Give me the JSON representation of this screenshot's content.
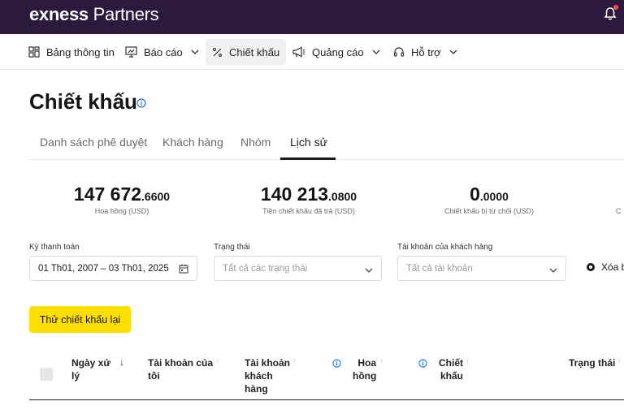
{
  "brand": {
    "name": "exness",
    "product": "Partners"
  },
  "nav": {
    "items": [
      {
        "label": "Bảng thông tin"
      },
      {
        "label": "Báo cáo"
      },
      {
        "label": "Chiết khấu"
      },
      {
        "label": "Quảng cáo"
      },
      {
        "label": "Hỗ trợ"
      }
    ]
  },
  "page": {
    "title": "Chiết khấu"
  },
  "tabs": [
    {
      "label": "Danh sách phê duyệt"
    },
    {
      "label": "Khách hàng"
    },
    {
      "label": "Nhóm"
    },
    {
      "label": "Lịch sử"
    }
  ],
  "stats": [
    {
      "main": "147 672",
      "decimal": ".6600",
      "label": "Hoa hồng (USD)"
    },
    {
      "main": "140 213",
      "decimal": ".0800",
      "label": "Tiền chiết khấu đã trả (USD)"
    },
    {
      "main": "0",
      "decimal": ".0000",
      "label": "Chiết khấu bị từ chối (USD)"
    },
    {
      "main": "",
      "decimal": "",
      "label": "C"
    }
  ],
  "filters": {
    "period": {
      "label": "Kỳ thanh toán",
      "value": "01 Th01, 2007 – 03 Th01, 2025"
    },
    "status": {
      "label": "Trạng thái",
      "placeholder": "Tất cả các trạng thái"
    },
    "account": {
      "label": "Tài khoản của khách hàng",
      "placeholder": "Tất cả tài khoản"
    },
    "clear_label": "Xóa b"
  },
  "retry_label": "Thử chiết khấu lại",
  "table": {
    "headers": {
      "date_line1": "Ngày xử",
      "date_line2": "lý",
      "myacc_line1": "Tài khoản của",
      "myacc_line2": "tôi",
      "clientacc_line1": "Tài khoản",
      "clientacc_line2": "khách",
      "clientacc_line3": "hàng",
      "commission_line1": "Hoa",
      "commission_line2": "hồng",
      "rebate_line1": "Chiết",
      "rebate_line2": "khấu",
      "status": "Trạng thái"
    }
  },
  "colors": {
    "topbar": "#2b1a3d",
    "accent": "#ffde02",
    "info": "#1e6fd9"
  }
}
